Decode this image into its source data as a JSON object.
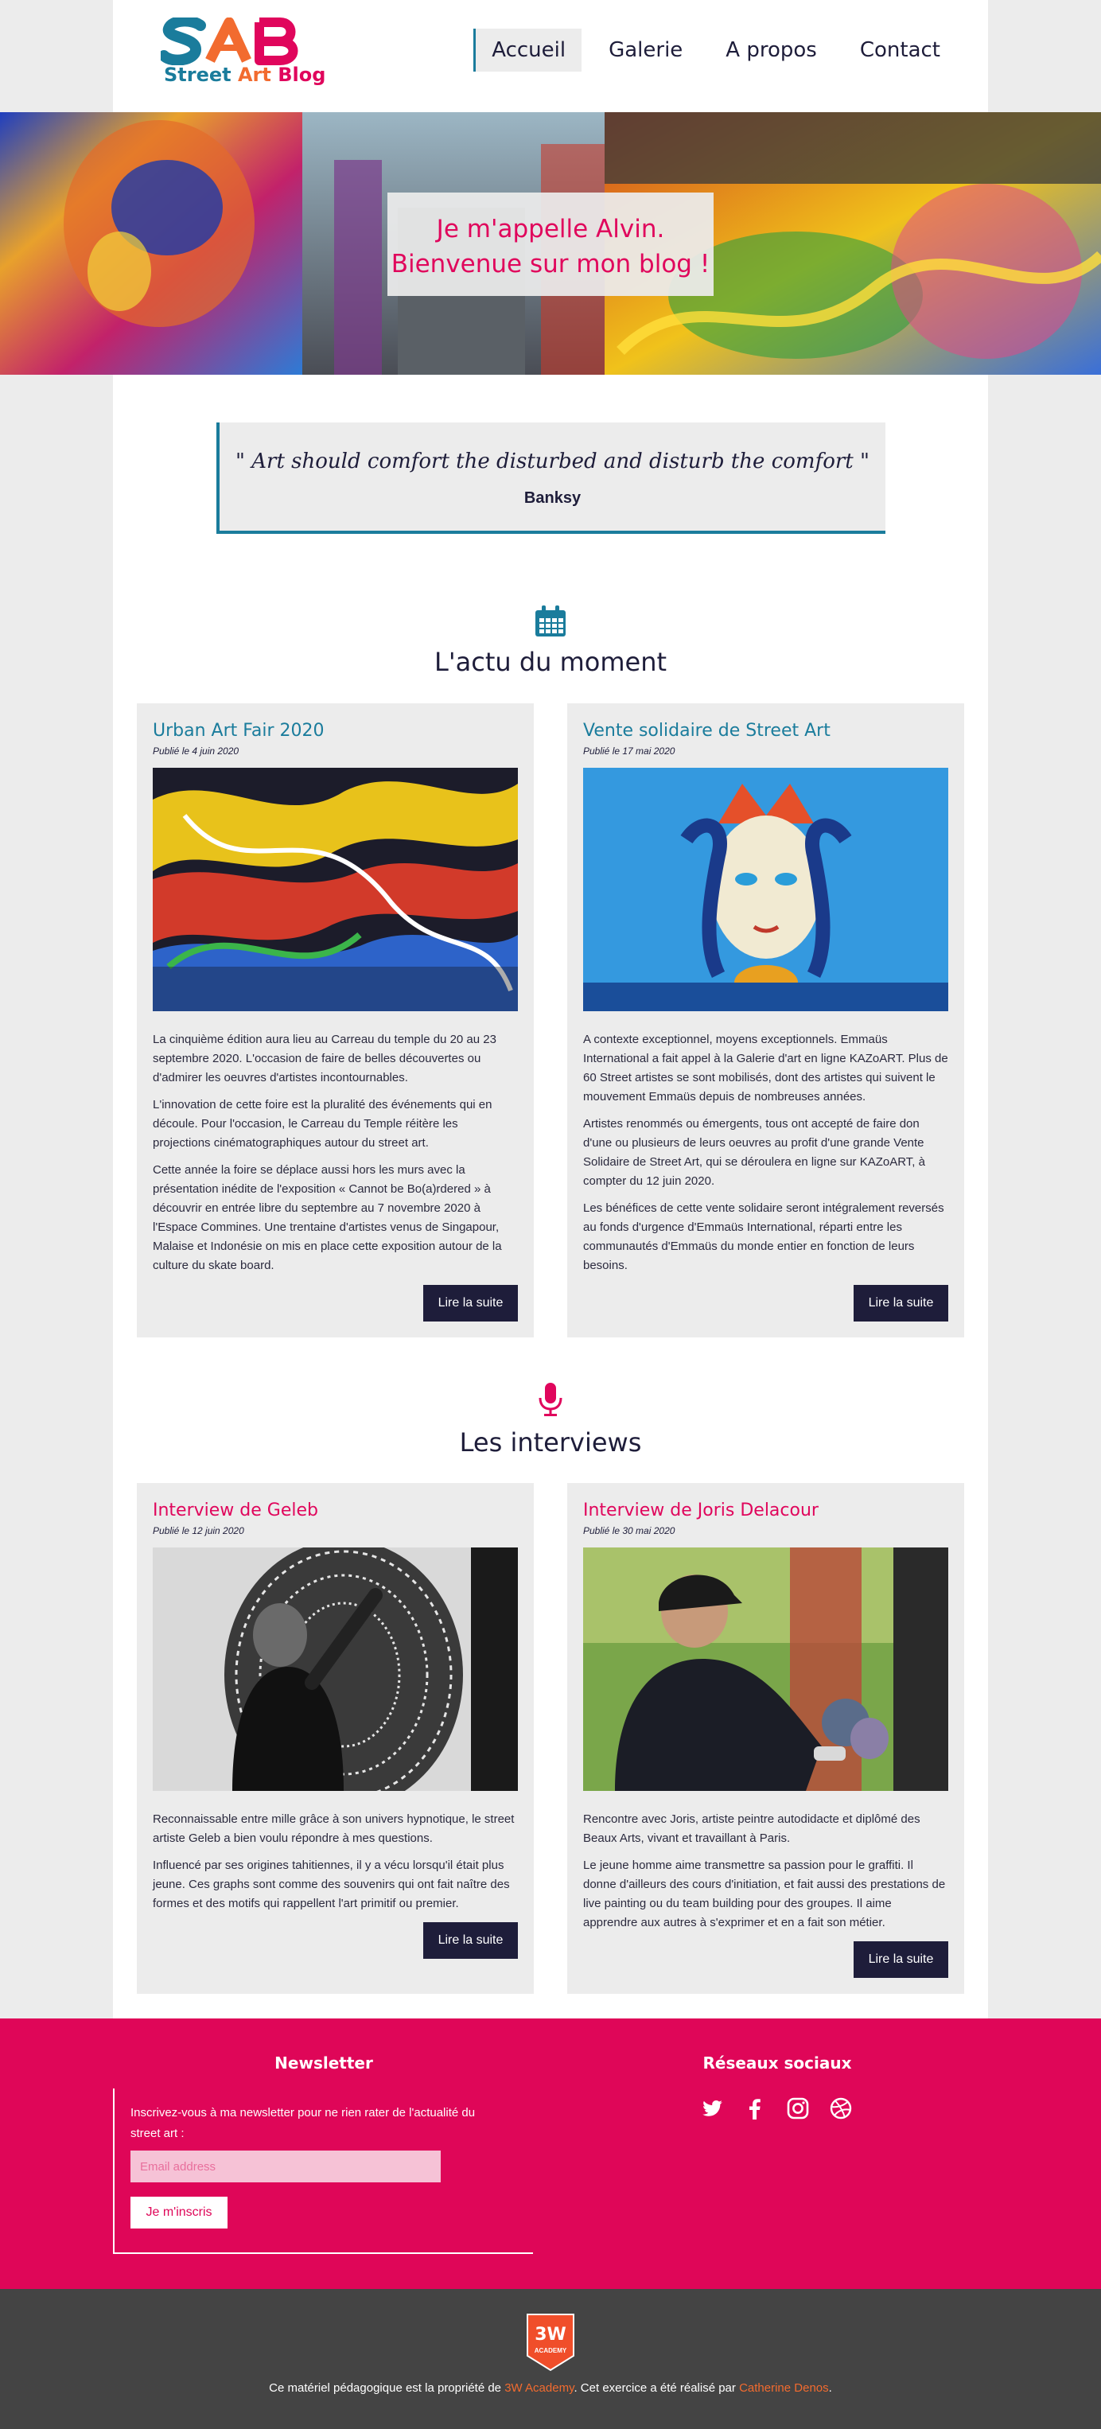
{
  "header": {
    "logo_letters": "SAB",
    "logo_word1": "Street",
    "logo_word2": "Art",
    "logo_word3": "Blog",
    "nav": [
      "Accueil",
      "Galerie",
      "A propos",
      "Contact"
    ],
    "active_nav": "Accueil"
  },
  "hero": {
    "line1": "Je m'appelle Alvin.",
    "line2": "Bienvenue sur mon blog !"
  },
  "quote": {
    "text": "\" Art should comfort the disturbed and disturb the comfort \"",
    "author": "Banksy"
  },
  "news": {
    "icon": "calendar-icon",
    "title": "L'actu du moment",
    "cards": [
      {
        "title": "Urban Art Fair 2020",
        "date": "Publié le 4 juin 2020",
        "paragraphs": [
          "La cinquième édition aura lieu au Carreau du temple du 20 au 23 septembre 2020. L'occasion de faire de belles découvertes ou d'admirer les oeuvres d'artistes incontournables.",
          "L'innovation de cette foire est la pluralité des événements qui en découle. Pour l'occasion, le Carreau du Temple réitère les projections cinématographiques autour du street art.",
          "Cette année la foire se déplace aussi hors les murs avec la présentation inédite de l'exposition « Cannot be Bo(a)rdered » à découvrir en entrée libre du septembre au 7 novembre 2020 à l'Espace Commines. Une trentaine d'artistes venus de Singapour, Malaise et Indonésie on mis en place cette exposition autour de la culture du skate board."
        ],
        "button": "Lire la suite"
      },
      {
        "title": "Vente solidaire de Street Art",
        "date": "Publié le 17 mai 2020",
        "paragraphs": [
          "A contexte exceptionnel, moyens exceptionnels. Emmaüs International a fait appel à la Galerie d'art en ligne KAZoART. Plus de 60 Street artistes se sont mobilisés, dont des artistes qui suivent le mouvement Emmaüs depuis de nombreuses années.",
          "Artistes renommés ou émergents, tous ont accepté de faire don d'une ou plusieurs de leurs oeuvres au profit d'une grande Vente Solidaire de Street Art, qui se déroulera en ligne sur KAZoART, à compter du 12 juin 2020.",
          "Les bénéfices de cette vente solidaire seront intégralement reversés au fonds d'urgence d'Emmaüs International, réparti entre les communautés d'Emmaüs du monde entier en fonction de leurs besoins."
        ],
        "button": "Lire la suite"
      }
    ]
  },
  "interviews": {
    "icon": "microphone-icon",
    "title": "Les interviews",
    "cards": [
      {
        "title": "Interview de Geleb",
        "date": "Publié le 12 juin 2020",
        "paragraphs": [
          "Reconnaissable entre mille grâce à son univers hypnotique, le street artiste Geleb a bien voulu répondre à mes questions.",
          "Influencé par ses origines tahitiennes, il y a vécu lorsqu'il était plus jeune. Ces graphs sont comme des souvenirs qui ont fait naître des formes et des motifs qui rappellent l'art primitif ou premier."
        ],
        "button": "Lire la suite"
      },
      {
        "title": "Interview de Joris Delacour",
        "date": "Publié le 30 mai 2020",
        "paragraphs": [
          "Rencontre avec Joris, artiste peintre autodidacte et diplômé des Beaux Arts, vivant et travaillant à Paris.",
          "Le jeune homme aime transmettre sa passion pour le graffiti. Il donne d'ailleurs des cours d'initiation, et fait aussi des prestations de live painting ou du team building pour des groupes. Il aime apprendre aux autres à s'exprimer et en a fait son métier."
        ],
        "button": "Lire la suite"
      }
    ]
  },
  "newsletter": {
    "title": "Newsletter",
    "text": "Inscrivez-vous à ma newsletter pour ne rien rater de l'actualité du street art :",
    "placeholder": "Email address",
    "button": "Je m'inscris"
  },
  "social": {
    "title": "Réseaux sociaux",
    "icons": [
      "twitter-icon",
      "facebook-icon",
      "instagram-icon",
      "dribbble-icon"
    ]
  },
  "footer": {
    "badge_top": "3W",
    "badge_bottom": "ACADEMY",
    "credits_before": "Ce matériel pédagogique est la propriété de ",
    "credits_link1": "3W Academy",
    "credits_middle": ". Cet exercice a été réalisé par ",
    "credits_link2": "Catherine Denos",
    "credits_after": "."
  },
  "colors": {
    "blue": "#1a7c9c",
    "pink": "#e0065c",
    "navy": "#1e1d3a",
    "grey": "#ececec",
    "footer_dark": "#444444",
    "orange": "#f26b2f"
  }
}
